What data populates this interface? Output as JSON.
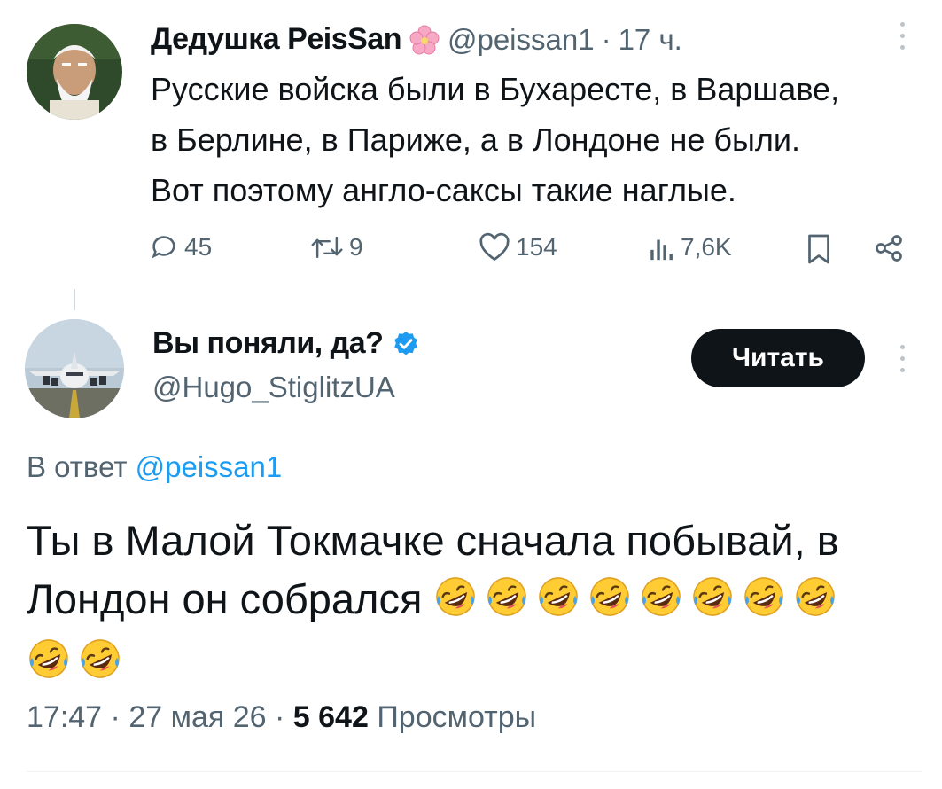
{
  "tweet1": {
    "author_name": "Дедушка PeisSan",
    "author_handle": "@peissan1",
    "separator": "·",
    "time": "17 ч.",
    "text_lines": [
      "Русские войска были в Бухаресте, в Варшаве,",
      "в Берлине, в Париже, а в Лондоне не были.",
      "Вот поэтому англо-саксы такие наглые."
    ],
    "actions": {
      "replies": "45",
      "retweets": "9",
      "likes": "154",
      "views": "7,6K"
    }
  },
  "tweet2": {
    "author_name": "Вы поняли, да?",
    "author_handle": "@Hugo_StiglitzUA",
    "read_button": "Читать",
    "reply_to_prefix": "В ответ",
    "reply_to_handle": "@peissan1",
    "text_line1": "Ты в Малой Токмачке сначала побывай, в",
    "text_line2": "Лондон он собрался",
    "emoji_count": 10,
    "emoji_name": "rolling-on-the-floor-laughing",
    "meta": {
      "time": "17:47",
      "separator": "·",
      "date": "27 мая 26",
      "views_count": "5 642",
      "views_label": "Просмотры"
    }
  },
  "colors": {
    "text": "#0f1419",
    "muted": "#536471",
    "link": "#1d9bf0",
    "verified": "#1d9bf0",
    "button_bg": "#0f1419"
  }
}
